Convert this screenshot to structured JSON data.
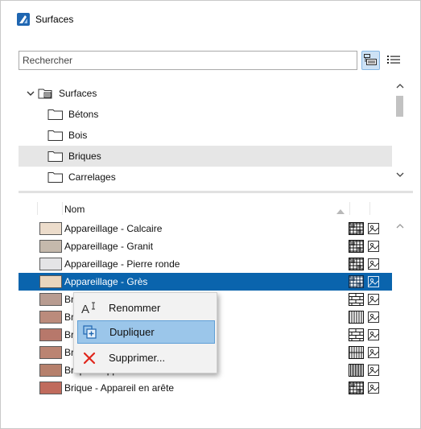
{
  "window": {
    "title": "Surfaces",
    "accent": "#0a64ad"
  },
  "search": {
    "placeholder": "Rechercher",
    "value": ""
  },
  "tree": {
    "root": {
      "label": "Surfaces",
      "expanded": true
    },
    "items": [
      {
        "label": "Bétons",
        "selected": false
      },
      {
        "label": "Bois",
        "selected": false
      },
      {
        "label": "Briques",
        "selected": true
      },
      {
        "label": "Carrelages",
        "selected": false
      }
    ]
  },
  "table": {
    "header": {
      "name": "Nom"
    },
    "rows": [
      {
        "label": "Appareillage - Calcaire",
        "color": "#ecdccb",
        "pattern": "grid-fine",
        "selected": false
      },
      {
        "label": "Appareillage - Granit",
        "color": "#c5b9ac",
        "pattern": "grid-fine",
        "selected": false
      },
      {
        "label": "Appareillage - Pierre ronde",
        "color": "#e4e4e6",
        "pattern": "grid-fine",
        "selected": false
      },
      {
        "label": "Appareillage - Grès",
        "color": "#e9d5bd",
        "pattern": "grid-fine",
        "selected": true
      },
      {
        "label": "Brique",
        "color": "#b89c91",
        "pattern": "brick",
        "selected": false
      },
      {
        "label": "Brique",
        "color": "#bb8b7c",
        "pattern": "dense",
        "selected": false
      },
      {
        "label": "Brique",
        "color": "#b7786b",
        "pattern": "brick",
        "selected": false
      },
      {
        "label": "Brique - Appareil damier",
        "color": "#bb8472",
        "pattern": "vertical",
        "selected": false
      },
      {
        "label": "Brique - Appareil debout",
        "color": "#b6806c",
        "pattern": "vertical-dense",
        "selected": false
      },
      {
        "label": "Brique - Appareil en arête",
        "color": "#c06b5d",
        "pattern": "grid-fine",
        "selected": false
      }
    ]
  },
  "context_menu": {
    "items": [
      {
        "label": "Renommer",
        "icon": "rename-icon",
        "hover": false
      },
      {
        "label": "Dupliquer",
        "icon": "duplicate-icon",
        "hover": true
      },
      {
        "label": "Supprimer...",
        "icon": "delete-icon",
        "hover": false
      }
    ]
  }
}
